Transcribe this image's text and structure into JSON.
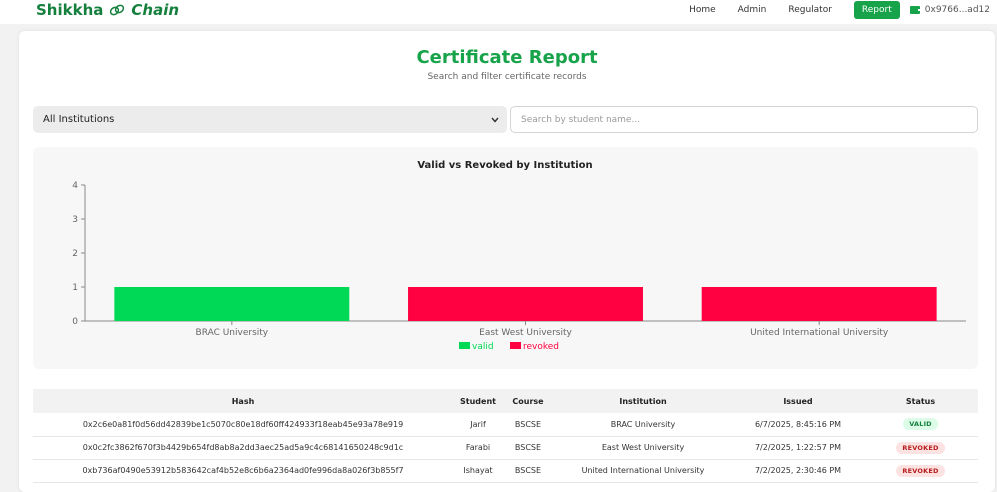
{
  "brand": {
    "part1": "Shikkha",
    "part2": "Chain",
    "logo_icon": "link-icon",
    "color": "#15803d"
  },
  "nav": {
    "items": [
      {
        "label": "Home",
        "active": false
      },
      {
        "label": "Admin",
        "active": false
      },
      {
        "label": "Regulator",
        "active": false
      },
      {
        "label": "Report",
        "active": true
      }
    ],
    "wallet_icon": "wallet-icon",
    "wallet_address": "0x9766...ad12",
    "accent_color": "#16a34a"
  },
  "header": {
    "title": "Certificate Report",
    "subtitle": "Search and filter certificate records"
  },
  "filters": {
    "institution_select": {
      "value": "All Institutions"
    },
    "search": {
      "placeholder": "Search by student name...",
      "value": ""
    }
  },
  "chart_data": {
    "type": "bar",
    "title": "Valid vs Revoked by Institution",
    "categories": [
      "BRAC University",
      "East West University",
      "United International University"
    ],
    "series": [
      {
        "name": "valid",
        "color": "#00d955",
        "values": [
          1,
          0,
          0
        ]
      },
      {
        "name": "revoked",
        "color": "#ff0040",
        "values": [
          0,
          1,
          1
        ]
      }
    ],
    "y_ticks": [
      0,
      1,
      2,
      3,
      4
    ],
    "ylim": [
      0,
      4
    ],
    "grid": false,
    "legend_position": "bottom-center"
  },
  "table": {
    "columns": [
      "Hash",
      "Student",
      "Course",
      "Institution",
      "Issued",
      "Status"
    ],
    "rows": [
      {
        "hash": "0x2c6e0a81f0d56dd42839be1c5070c80e18df60ff424933f18eab45e93a78e919",
        "student": "Jarif",
        "course": "BSCSE",
        "institution": "BRAC University",
        "issued": "6/7/2025, 8:45:16 PM",
        "status": "VALID"
      },
      {
        "hash": "0x0c2fc3862f670f3b4429b654fd8ab8a2dd3aec25ad5a9c4c68141650248c9d1c",
        "student": "Farabi",
        "course": "BSCSE",
        "institution": "East West University",
        "issued": "7/2/2025, 1:22:57 PM",
        "status": "REVOKED"
      },
      {
        "hash": "0xb736af0490e53912b583642caf4b52e8c6b6a2364ad0fe996da8a026f3b855f7",
        "student": "Ishayat",
        "course": "BSCSE",
        "institution": "United International University",
        "issued": "7/2/2025, 2:30:46 PM",
        "status": "REVOKED"
      }
    ]
  }
}
